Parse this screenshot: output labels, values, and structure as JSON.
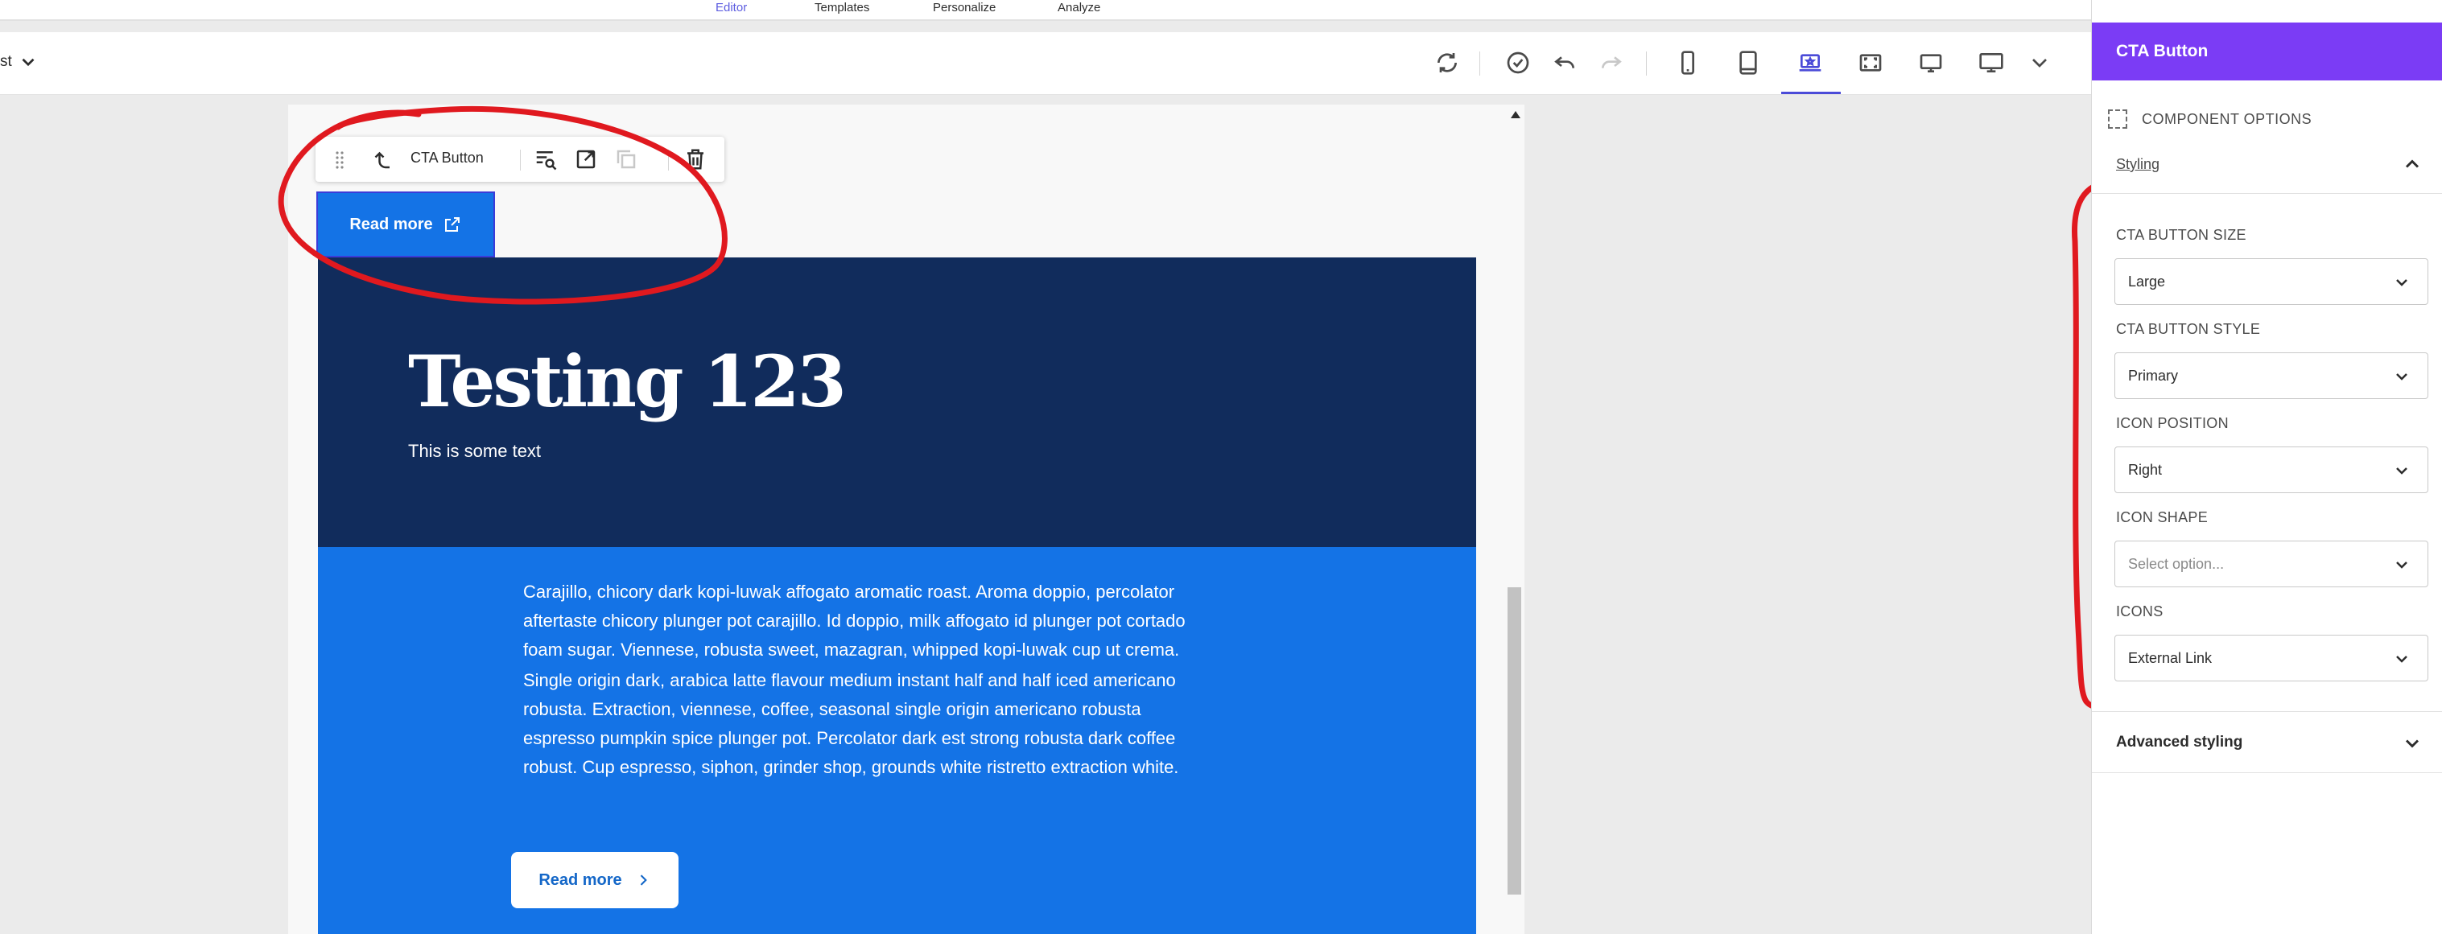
{
  "nav": {
    "tabs": [
      {
        "label": "Editor"
      },
      {
        "label": "Templates"
      },
      {
        "label": "Personalize"
      },
      {
        "label": "Analyze"
      }
    ]
  },
  "toolbar": {
    "breadcrumb": "st",
    "icons": [
      "refresh-icon",
      "check-circle-icon",
      "undo-icon",
      "redo-icon",
      "mobile-icon",
      "tablet-icon",
      "laptop-star-icon",
      "fullscreen-icon",
      "desktop-icon",
      "monitor-icon",
      "chevron-down-icon"
    ]
  },
  "component_toolbar": {
    "label": "CTA Button",
    "icons": [
      "drag-handle-icon",
      "select-parent-icon",
      "inspect-icon",
      "open-external-icon",
      "duplicate-icon",
      "delete-icon"
    ]
  },
  "canvas": {
    "selected_button": {
      "label": "Read more"
    },
    "hero": {
      "title": "Testing 123",
      "subtitle": "This is some text"
    },
    "paragraphs": [
      "Carajillo, chicory dark kopi-luwak affogato aromatic roast. Aroma doppio, percolator aftertaste chicory plunger pot carajillo. Id doppio, milk affogato id plunger pot cortado foam sugar. Viennese, robusta sweet, mazagran, whipped kopi-luwak cup ut crema.",
      "Single origin dark, arabica latte flavour medium instant half and half iced americano robusta. Extraction, viennese, coffee, seasonal single origin americano robusta espresso pumpkin spice plunger pot. Percolator dark est strong robusta dark coffee robust. Cup espresso, siphon, grinder shop, grounds white ristretto extraction white."
    ],
    "read_more_button": {
      "label": "Read more"
    }
  },
  "panel": {
    "title": "CTA Button",
    "component_options": "COMPONENT OPTIONS",
    "styling_tab": "Styling",
    "fields": [
      {
        "label": "CTA BUTTON SIZE",
        "value": "Large",
        "placeholder": false
      },
      {
        "label": "CTA BUTTON STYLE",
        "value": "Primary",
        "placeholder": false
      },
      {
        "label": "ICON POSITION",
        "value": "Right",
        "placeholder": false
      },
      {
        "label": "ICON SHAPE",
        "value": "Select option...",
        "placeholder": true
      },
      {
        "label": "ICONS",
        "value": "External Link",
        "placeholder": false
      }
    ],
    "advanced_styling": "Advanced styling"
  },
  "colors": {
    "accent": "#7b3cf5",
    "hero_bg": "#112c5c",
    "content_bg": "#1473e6",
    "annotation": "#e0191f",
    "active_tool": "#4b4bd8"
  }
}
